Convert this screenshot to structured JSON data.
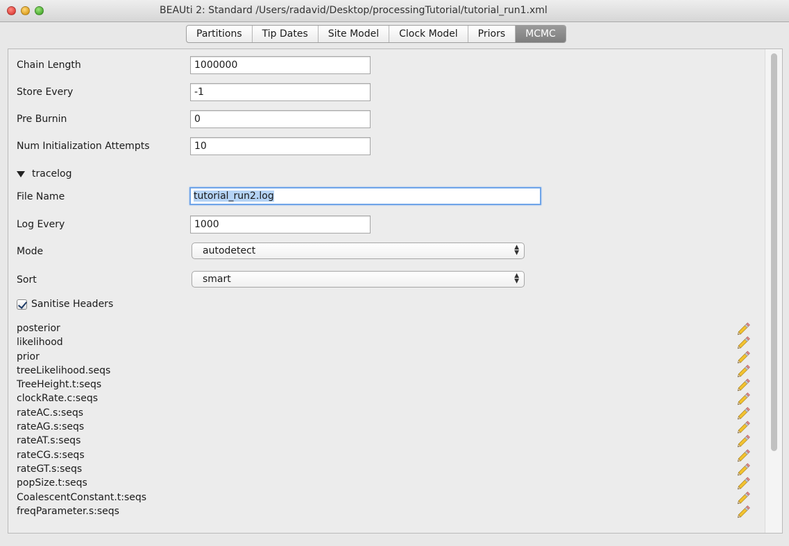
{
  "window": {
    "title": "BEAUti 2: Standard /Users/radavid/Desktop/processingTutorial/tutorial_run1.xml"
  },
  "tabs": [
    {
      "label": "Partitions"
    },
    {
      "label": "Tip Dates"
    },
    {
      "label": "Site Model"
    },
    {
      "label": "Clock Model"
    },
    {
      "label": "Priors"
    },
    {
      "label": "MCMC",
      "active": true
    }
  ],
  "mcmc": {
    "chain_length": {
      "label": "Chain Length",
      "value": "1000000"
    },
    "store_every": {
      "label": "Store Every",
      "value": "-1"
    },
    "pre_burnin": {
      "label": "Pre Burnin",
      "value": "0"
    },
    "num_init": {
      "label": "Num Initialization Attempts",
      "value": "10"
    }
  },
  "tracelog": {
    "section_label": "tracelog",
    "file_name": {
      "label": "File Name",
      "value": "tutorial_run2.log"
    },
    "log_every": {
      "label": "Log Every",
      "value": "1000"
    },
    "mode": {
      "label": "Mode",
      "value": "autodetect"
    },
    "sort": {
      "label": "Sort",
      "value": "smart"
    },
    "sanitise": {
      "label": "Sanitise Headers",
      "checked": true
    },
    "loggers": [
      "posterior",
      "likelihood",
      "prior",
      "treeLikelihood.seqs",
      "TreeHeight.t:seqs",
      "clockRate.c:seqs",
      "rateAC.s:seqs",
      "rateAG.s:seqs",
      "rateAT.s:seqs",
      "rateCG.s:seqs",
      "rateGT.s:seqs",
      "popSize.t:seqs",
      "CoalescentConstant.t:seqs",
      "freqParameter.s:seqs"
    ],
    "edit_icon": "pencil-icon"
  },
  "colors": {
    "active_tab": "#8a8a8a",
    "focus_ring": "#6fa4e8",
    "selection": "#b5d3f5"
  }
}
